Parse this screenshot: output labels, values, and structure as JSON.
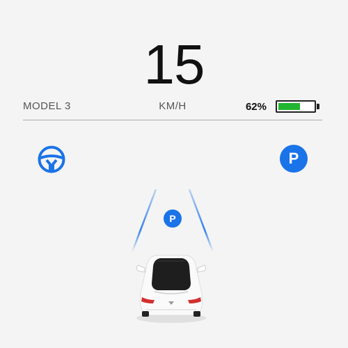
{
  "speed": {
    "value": "15",
    "unit": "KM/H"
  },
  "vehicle": {
    "model": "MODEL 3"
  },
  "battery": {
    "percent_label": "62%",
    "level": 0.62,
    "fill_color": "#22b531"
  },
  "indicators": {
    "autosteer": {
      "icon": "steering-wheel-icon",
      "color": "#1a73e8"
    },
    "park": {
      "icon": "park-icon",
      "label": "P",
      "color": "#1a73e8"
    }
  },
  "scene": {
    "parking_spot": {
      "label": "P"
    },
    "lane_color": "#1a73e8"
  }
}
